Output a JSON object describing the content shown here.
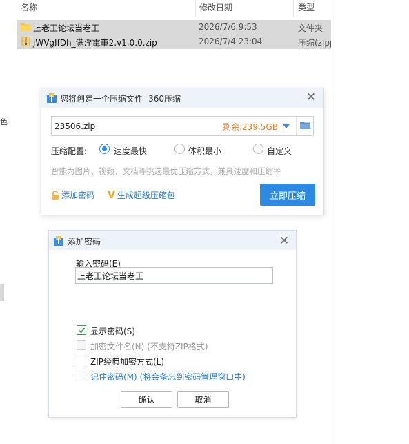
{
  "explorer": {
    "columns": {
      "name": "名称",
      "date": "修改日期",
      "type": "类型"
    },
    "files": [
      {
        "name": "上老王论坛当老王",
        "date": "2026/7/6 9:53",
        "type": "文件夹",
        "icon": "folder-icon"
      },
      {
        "name": "jWVgIfDh_满淫電車2.v1.0.0.zip",
        "date": "2026/7/4 23:04",
        "type": "压缩(zipped)",
        "icon": "zip-file-icon"
      }
    ],
    "left_strip_char": "色"
  },
  "compress_dialog": {
    "title": "您将创建一个压缩文件 -360压缩",
    "filename": "23506.zip",
    "free_space": "剩余:239.5GB",
    "options_label": "压缩配置:",
    "options": [
      {
        "label": "速度最快",
        "selected": true
      },
      {
        "label": "体积最小",
        "selected": false
      },
      {
        "label": "自定义",
        "selected": false
      }
    ],
    "hint": "智能为图片、视频、文档等挑选最优压缩方式，兼具速度和压缩率",
    "add_password_link": "添加密码",
    "super_pack_link": "生成超级压缩包",
    "compress_button": "立即压缩",
    "accent_color": "#2d8ae0"
  },
  "password_dialog": {
    "title": "添加密码",
    "input_label": "输入密码(E)",
    "password_value": "上老王论坛当老王",
    "checkboxes": [
      {
        "label": "显示密码(S)",
        "checked": true,
        "disabled": false
      },
      {
        "label": "加密文件名(N) (不支持ZIP格式)",
        "checked": false,
        "disabled": true
      },
      {
        "label": "ZIP经典加密方式(L)",
        "checked": false,
        "disabled": false
      },
      {
        "label": "记住密码(M) (将会备忘到密码管理窗口中)",
        "checked": false,
        "disabled": false
      }
    ],
    "ok_button": "确认",
    "cancel_button": "取消"
  }
}
